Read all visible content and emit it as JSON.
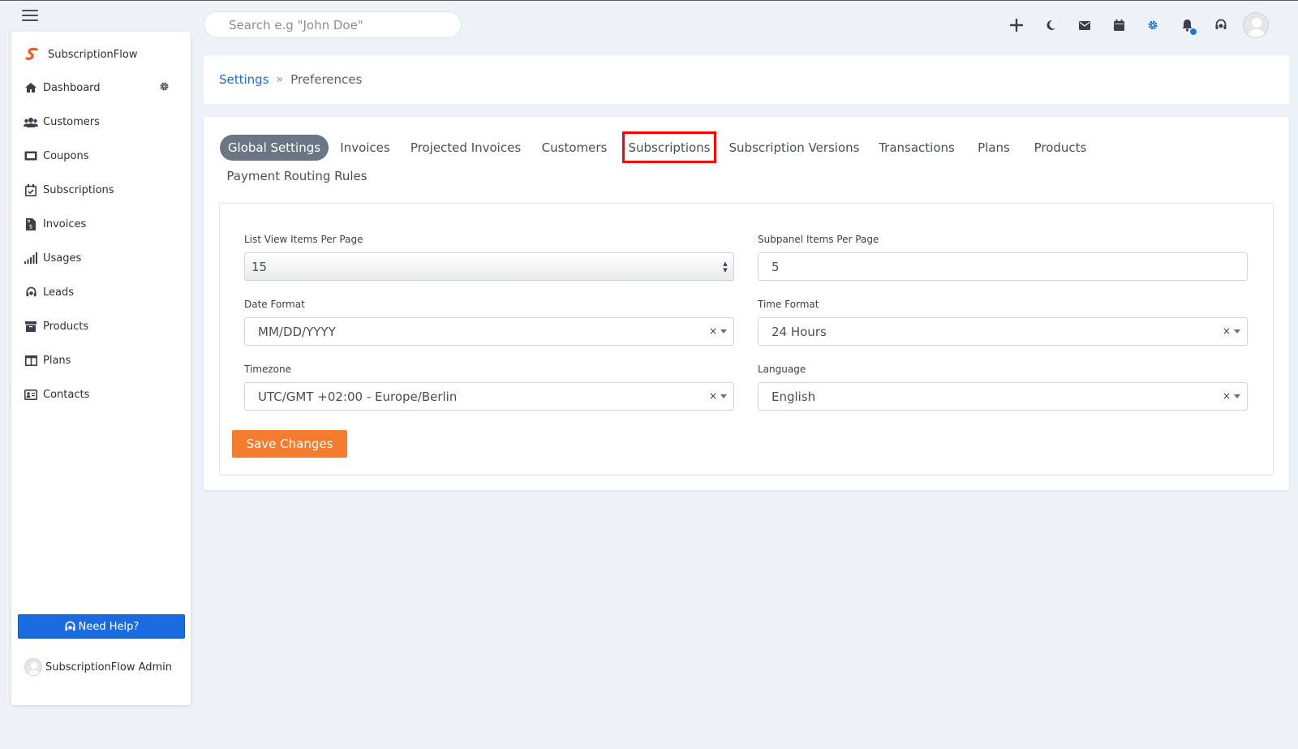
{
  "topbar": {
    "search_placeholder": "Search e.g \"John Doe\"",
    "icons": [
      "plus-icon",
      "moon-icon",
      "mail-icon",
      "calendar-icon",
      "gear-icon",
      "bell-icon",
      "headset-icon",
      "user-avatar"
    ]
  },
  "sidebar": {
    "brand": "SubscriptionFlow",
    "items": [
      {
        "label": "Dashboard",
        "icon": "home-icon"
      },
      {
        "label": "Customers",
        "icon": "users-icon"
      },
      {
        "label": "Coupons",
        "icon": "coupon-icon"
      },
      {
        "label": "Subscriptions",
        "icon": "calendar-check-icon"
      },
      {
        "label": "Invoices",
        "icon": "invoice-icon"
      },
      {
        "label": "Usages",
        "icon": "signal-bars-icon"
      },
      {
        "label": "Leads",
        "icon": "headset-icon"
      },
      {
        "label": "Products",
        "icon": "archive-icon"
      },
      {
        "label": "Plans",
        "icon": "columns-icon"
      },
      {
        "label": "Contacts",
        "icon": "address-card-icon"
      }
    ],
    "help_label": "Need Help?",
    "user_name": "SubscriptionFlow Admin"
  },
  "breadcrumb": {
    "root": "Settings",
    "separator": "»",
    "current": "Preferences"
  },
  "tabs": [
    {
      "label": "Global Settings",
      "active": true
    },
    {
      "label": "Invoices"
    },
    {
      "label": "Projected Invoices"
    },
    {
      "label": "Customers"
    },
    {
      "label": "Subscriptions",
      "highlighted": true
    },
    {
      "label": "Subscription Versions"
    },
    {
      "label": "Transactions"
    },
    {
      "label": "Plans"
    },
    {
      "label": "Products"
    },
    {
      "label": "Payment Routing Rules"
    }
  ],
  "form": {
    "list_view_label": "List View Items Per Page",
    "list_view_value": "15",
    "subpanel_label": "Subpanel Items Per Page",
    "subpanel_value": "5",
    "date_format_label": "Date Format",
    "date_format_value": "MM/DD/YYYY",
    "time_format_label": "Time Format",
    "time_format_value": "24 Hours",
    "timezone_label": "Timezone",
    "timezone_value": "UTC/GMT +02:00 - Europe/Berlin",
    "language_label": "Language",
    "language_value": "English",
    "clear_glyph": "×",
    "save_label": "Save Changes"
  },
  "colors": {
    "accent": "#1a6be0",
    "save": "#f47c2f",
    "active_tab": "#6b7684",
    "highlight": "#ff0000"
  }
}
